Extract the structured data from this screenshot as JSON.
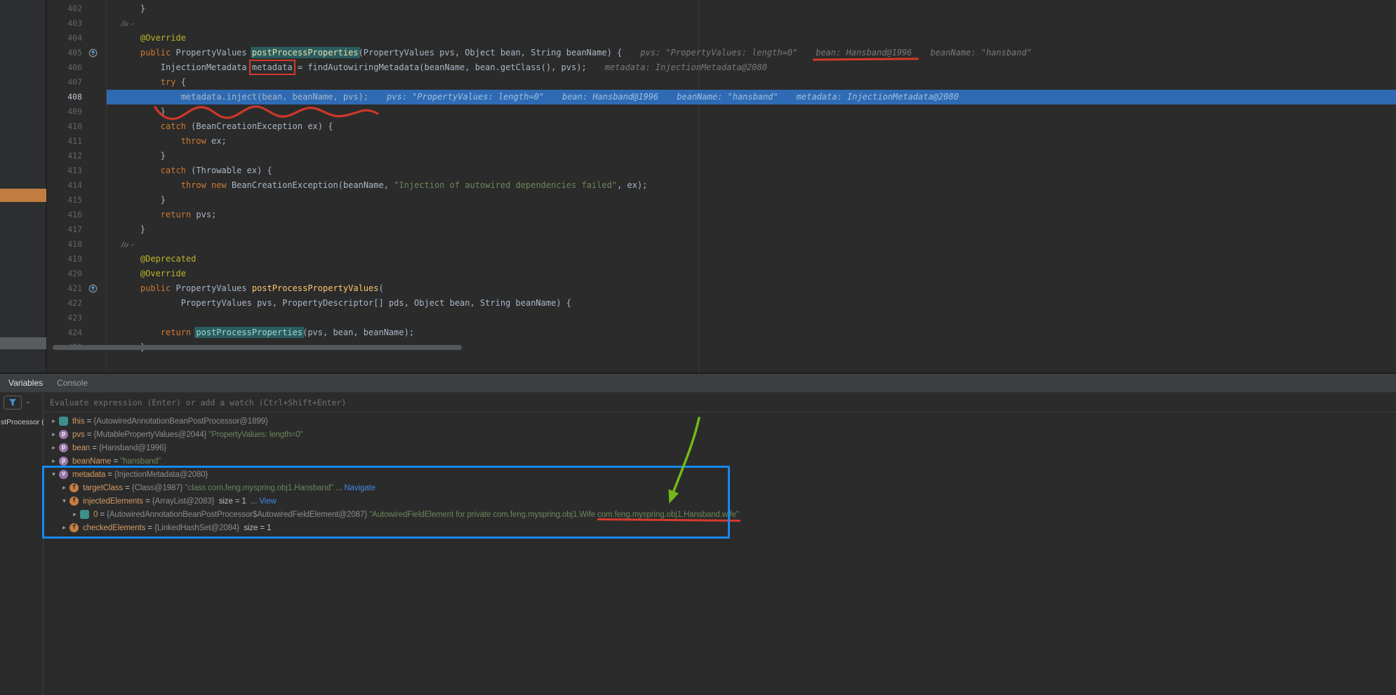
{
  "colors": {
    "exec": "#2f6bb4",
    "teal": "#2b5d5f",
    "plain": "#a9b7c6",
    "keyword": "#cc7832",
    "annotation": "#bbb529",
    "string": "#6a8759",
    "method": "#ffc66d",
    "hint": "#787878",
    "name": "#d19a66",
    "gray": "#8c8c8c",
    "link": "#3d8ae5",
    "red": "#d6392b",
    "green": "#74b816",
    "blue": "#1688f0"
  },
  "icons": {
    "filter": "funnel-icon",
    "filter_chevron": "chevron-down-icon",
    "gutter_override": "overriding-method-icon",
    "method_inlay": "inferred-annotations-icon",
    "collapsed": "chevron-right-icon",
    "expanded": "chevron-down-icon"
  },
  "editor": {
    "current_line": "408",
    "lines": [
      {
        "num": "402",
        "tokens": [
          [
            "    }",
            "p"
          ]
        ]
      },
      {
        "num": "403",
        "tokens": [],
        "inlay": true
      },
      {
        "num": "404",
        "tokens": [
          [
            "    ",
            "p"
          ],
          [
            "@Override",
            "a"
          ]
        ]
      },
      {
        "num": "405",
        "gutter": "override",
        "tokens": [
          [
            "    ",
            "p"
          ],
          [
            "public",
            "k"
          ],
          [
            " PropertyValues ",
            "p"
          ],
          [
            "postProcessProperties",
            "hlm"
          ],
          [
            "(PropertyValues pvs, Object bean, String beanName) {",
            "p"
          ]
        ],
        "hints": [
          {
            "t": "pvs: \"PropertyValues: length=0\""
          },
          {
            "t": "bean: Hansband@1996",
            "u": true
          },
          {
            "t": "beanName: \"hansband\""
          }
        ]
      },
      {
        "num": "406",
        "tokens": [
          [
            "        InjectionMetadata ",
            "p"
          ],
          [
            "metadata",
            "box"
          ],
          [
            " = findAutowiringMetadata(beanName, bean.getClass(), pvs);",
            "p"
          ]
        ],
        "hints": [
          {
            "t": "metadata: InjectionMetadata@2080"
          }
        ]
      },
      {
        "num": "407",
        "tokens": [
          [
            "        ",
            "p"
          ],
          [
            "try",
            "k"
          ],
          [
            " {",
            "p"
          ]
        ]
      },
      {
        "num": "408",
        "exec": true,
        "tokens": [
          [
            "            metadata.inject(bean, beanName, pvs);",
            "p"
          ]
        ],
        "hints": [
          {
            "t": "pvs: \"PropertyValues: length=0\""
          },
          {
            "t": "bean: Hansband@1996"
          },
          {
            "t": "beanName: \"hansband\""
          },
          {
            "t": "metadata: InjectionMetadata@2080"
          }
        ]
      },
      {
        "num": "409",
        "tokens": [
          [
            "        }",
            "p"
          ]
        ]
      },
      {
        "num": "410",
        "tokens": [
          [
            "        ",
            "p"
          ],
          [
            "catch",
            "k"
          ],
          [
            " (BeanCreationException ex) {",
            "p"
          ]
        ]
      },
      {
        "num": "411",
        "tokens": [
          [
            "            ",
            "p"
          ],
          [
            "throw",
            "k"
          ],
          [
            " ex;",
            "p"
          ]
        ]
      },
      {
        "num": "412",
        "tokens": [
          [
            "        }",
            "p"
          ]
        ]
      },
      {
        "num": "413",
        "tokens": [
          [
            "        ",
            "p"
          ],
          [
            "catch",
            "k"
          ],
          [
            " (Throwable ex) {",
            "p"
          ]
        ]
      },
      {
        "num": "414",
        "tokens": [
          [
            "            ",
            "p"
          ],
          [
            "throw",
            "k"
          ],
          [
            " ",
            "p"
          ],
          [
            "new",
            "k"
          ],
          [
            " BeanCreationException(beanName, ",
            "p"
          ],
          [
            "\"Injection of autowired dependencies failed\"",
            "s"
          ],
          [
            ", ex);",
            "p"
          ]
        ]
      },
      {
        "num": "415",
        "tokens": [
          [
            "        }",
            "p"
          ]
        ]
      },
      {
        "num": "416",
        "tokens": [
          [
            "        ",
            "p"
          ],
          [
            "return",
            "k"
          ],
          [
            " pvs;",
            "p"
          ]
        ]
      },
      {
        "num": "417",
        "tokens": [
          [
            "    }",
            "p"
          ]
        ]
      },
      {
        "num": "418",
        "tokens": [],
        "inlay": true
      },
      {
        "num": "419",
        "tokens": [
          [
            "    ",
            "p"
          ],
          [
            "@Deprecated",
            "a"
          ]
        ]
      },
      {
        "num": "420",
        "tokens": [
          [
            "    ",
            "p"
          ],
          [
            "@Override",
            "a"
          ]
        ]
      },
      {
        "num": "421",
        "gutter": "override",
        "tokens": [
          [
            "    ",
            "p"
          ],
          [
            "public",
            "k"
          ],
          [
            " PropertyValues ",
            "p"
          ],
          [
            "postProcessPropertyValues",
            "m"
          ],
          [
            "(",
            "p"
          ]
        ]
      },
      {
        "num": "422",
        "tokens": [
          [
            "            PropertyValues pvs, PropertyDescriptor[] pds, Object bean, String beanName) {",
            "p"
          ]
        ]
      },
      {
        "num": "423",
        "tokens": []
      },
      {
        "num": "424",
        "tokens": [
          [
            "        ",
            "p"
          ],
          [
            "return",
            "k"
          ],
          [
            " ",
            "p"
          ],
          [
            "postProcessProperties",
            "hl"
          ],
          [
            "(pvs, bean, beanName);",
            "p"
          ]
        ]
      },
      {
        "num": "425",
        "tokens": [
          [
            "    }",
            "p"
          ]
        ]
      }
    ]
  },
  "debug": {
    "tabs": [
      {
        "label": "Variables",
        "active": true
      },
      {
        "label": "Console",
        "active": false
      }
    ],
    "evaluate_placeholder": "Evaluate expression (Enter) or add a watch (Ctrl+Shift+Enter)",
    "frames_fragment": "stProcessor (",
    "tree": [
      {
        "d": 0,
        "x": "r",
        "i": "o",
        "segs": [
          [
            "this",
            "n"
          ],
          [
            " = ",
            "eq"
          ],
          [
            "{AutowiredAnnotationBeanPostProcessor@1899}",
            "g"
          ]
        ]
      },
      {
        "d": 0,
        "x": "r",
        "i": "p",
        "segs": [
          [
            "pvs",
            "n"
          ],
          [
            " = ",
            "eq"
          ],
          [
            "{MutablePropertyValues@2044} ",
            "g"
          ],
          [
            "\"PropertyValues: length=0\"",
            "str"
          ]
        ]
      },
      {
        "d": 0,
        "x": "r",
        "i": "p",
        "segs": [
          [
            "bean",
            "n"
          ],
          [
            " = ",
            "eq"
          ],
          [
            "{Hansband@1996}",
            "g"
          ]
        ]
      },
      {
        "d": 0,
        "x": "r",
        "i": "p",
        "segs": [
          [
            "beanName",
            "n"
          ],
          [
            " = ",
            "eq"
          ],
          [
            "\"hansband\"",
            "str"
          ]
        ]
      },
      {
        "d": 0,
        "x": "d",
        "i": "v",
        "segs": [
          [
            "metadata",
            "n"
          ],
          [
            " = ",
            "eq"
          ],
          [
            "{InjectionMetadata@2080}",
            "g"
          ]
        ]
      },
      {
        "d": 1,
        "x": "r",
        "i": "f",
        "segs": [
          [
            "targetClass",
            "n"
          ],
          [
            " = ",
            "eq"
          ],
          [
            "{Class@1987} ",
            "g"
          ],
          [
            "\"class com.feng.myspring.obj1.Hansband\"",
            "str"
          ],
          [
            " ... ",
            "g"
          ],
          [
            "Navigate",
            "lnk"
          ]
        ]
      },
      {
        "d": 1,
        "x": "d",
        "i": "f",
        "segs": [
          [
            "injectedElements",
            "n"
          ],
          [
            " = ",
            "eq"
          ],
          [
            "{ArrayList@2083} ",
            "g"
          ],
          [
            " size = 1 ",
            "sz"
          ],
          [
            " ... ",
            "g"
          ],
          [
            "View",
            "lnk"
          ]
        ]
      },
      {
        "d": 2,
        "x": "r",
        "i": "o",
        "segs": [
          [
            "0",
            "n"
          ],
          [
            " = ",
            "eq"
          ],
          [
            "{AutowiredAnnotationBeanPostProcessor$AutowiredFieldElement@2087} ",
            "g"
          ],
          [
            "\"AutowiredFieldElement for private com.feng.myspring.obj1.Wife ",
            "str"
          ],
          [
            "com.feng.myspring.obj1.Hansband.wife\"",
            "str u"
          ]
        ]
      },
      {
        "d": 1,
        "x": "r",
        "i": "f",
        "segs": [
          [
            "checkedElements",
            "n"
          ],
          [
            " = ",
            "eq"
          ],
          [
            "{LinkedHashSet@2084} ",
            "g"
          ],
          [
            " size = 1",
            "sz"
          ]
        ]
      }
    ]
  }
}
